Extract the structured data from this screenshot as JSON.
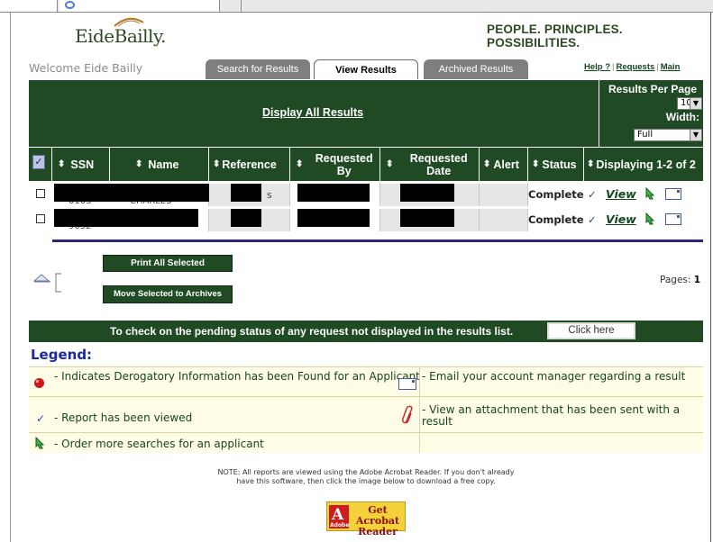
{
  "brand": {
    "logo_text": "EideBailly.",
    "tagline": "PEOPLE. PRINCIPLES. POSSIBILITIES."
  },
  "welcome": "Welcome Eide Bailly",
  "tabs": [
    {
      "label": "Search for Results",
      "active": false
    },
    {
      "label": "View Results",
      "active": true
    },
    {
      "label": "Archived Results",
      "active": false
    }
  ],
  "links": {
    "help": "Help ?",
    "sep": "|",
    "requests": "Requests",
    "main": "Main"
  },
  "results": {
    "display_all": "Display All Results",
    "per_page_label": "Results Per Page",
    "per_page_value": "10",
    "width_label": "Width:",
    "width_value": "Full",
    "displaying": "Displaying 1-2 of 2"
  },
  "columns": {
    "ssn": "SSN",
    "name": "Name",
    "reference": "Reference",
    "requested_by": "Requested By",
    "requested_date": "Requested Date",
    "alert": "Alert",
    "status": "Status",
    "sort_glyph": "⬍"
  },
  "rows": [
    {
      "ssn_tail": "0103",
      "name_part": "CHARLES",
      "ref_tail": "s",
      "status": "Complete",
      "viewed": "✓",
      "view": "View"
    },
    {
      "ssn_tail": "9052",
      "name_part": "",
      "ref_tail": "",
      "status": "Complete",
      "viewed": "✓",
      "view": "View"
    }
  ],
  "actions": {
    "print_selected": "Print All Selected",
    "move_archives": "Move Selected to Archives",
    "pages_label": "Pages:",
    "pages_value": "1"
  },
  "pending": {
    "text": "To check on the pending status of any request not displayed in the results list.",
    "button": "Click here"
  },
  "legend": {
    "title": "Legend:",
    "items": [
      {
        "icon": "red-dot-icon",
        "text": "- Indicates Derogatory Information has been Found for an Applicant"
      },
      {
        "icon": "envelope-icon",
        "text": "- Email your account manager regarding a result"
      },
      {
        "icon": "checkmark-icon",
        "text": "- Report has been viewed"
      },
      {
        "icon": "paperclip-icon",
        "text": "- View an attachment that has been sent with a result"
      },
      {
        "icon": "green-arrow-icon",
        "text": "- Order more searches for an applicant"
      }
    ]
  },
  "note": {
    "line1": "NOTE: All reports are viewed using the Adobe Acrobat Reader. If you don't already",
    "line2": "have this software, then click the image below to download a free copy."
  },
  "acrobat": {
    "brand": "Adobe",
    "line1": "Get Acrobat",
    "line2": "Reader"
  },
  "colors": {
    "brand_green": "#1f4a24",
    "legend_bg": "#fffde6",
    "legend_title": "#1a2a9a"
  }
}
